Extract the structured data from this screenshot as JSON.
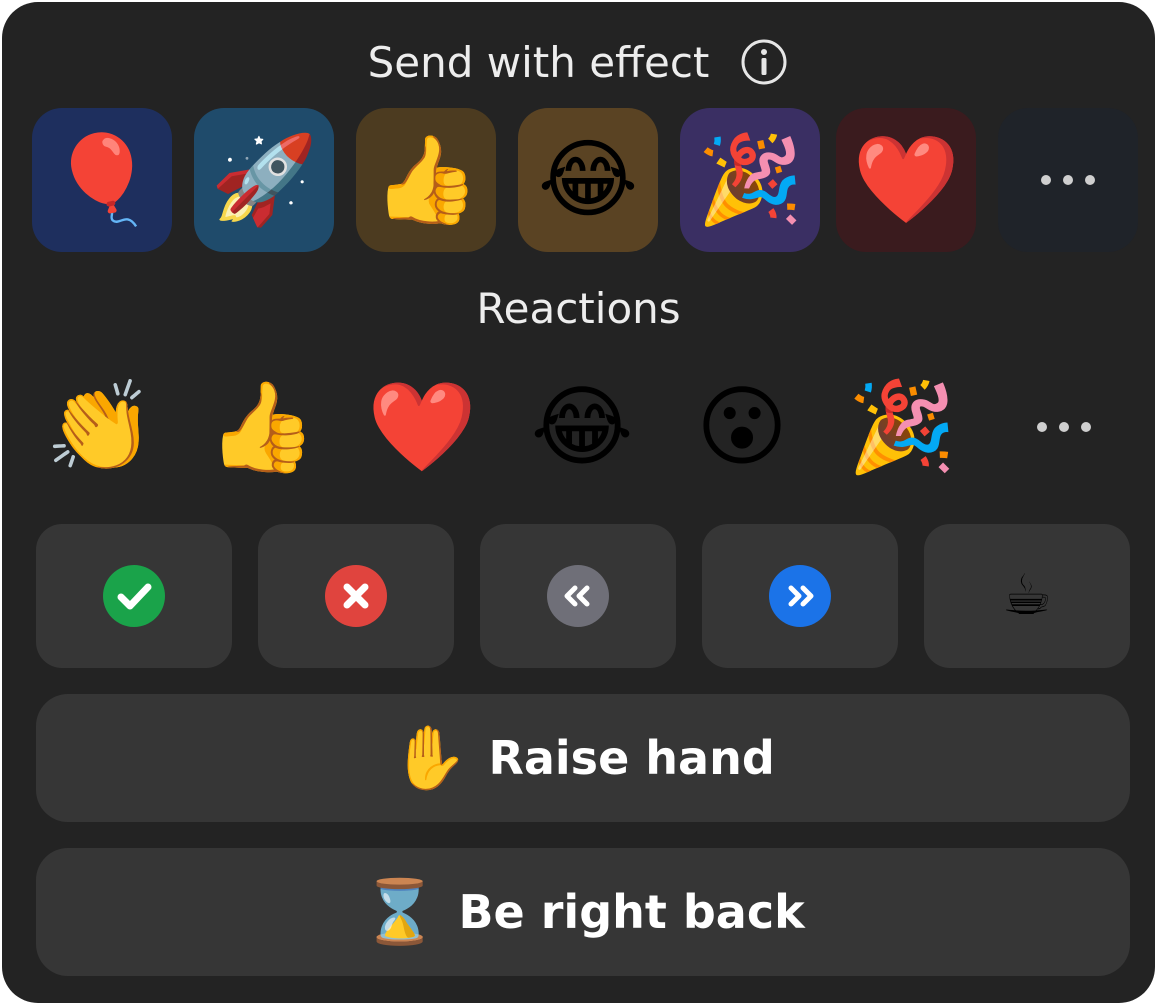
{
  "header": {
    "title": "Send with effect",
    "info_icon": "info-circle-icon"
  },
  "effects": [
    {
      "name": "balloon",
      "icon": "balloon-icon",
      "glyph": "🎈",
      "bg": "#1e2f5e"
    },
    {
      "name": "rocket",
      "icon": "rocket-icon",
      "glyph": "🚀",
      "bg": "#1f4b6b"
    },
    {
      "name": "thumbs-up",
      "icon": "thumbs-up-icon",
      "glyph": "👍",
      "bg": "#4c3b20"
    },
    {
      "name": "tears-of-joy",
      "icon": "tears-of-joy-icon",
      "glyph": "😂",
      "bg": "#5a4323"
    },
    {
      "name": "party",
      "icon": "party-popper-icon",
      "glyph": "🎉",
      "bg": "#3a2f63"
    },
    {
      "name": "heart",
      "icon": "heart-icon",
      "glyph": "❤️",
      "bg": "#3a1b1e"
    },
    {
      "name": "more",
      "icon": "more-icon",
      "glyph": "",
      "bg": "#1f2329"
    }
  ],
  "reactions_section": {
    "label": "Reactions",
    "items": [
      {
        "name": "clap",
        "icon": "clapping-hands-icon",
        "glyph": "👏"
      },
      {
        "name": "thumbs-up",
        "icon": "thumbs-up-icon",
        "glyph": "👍"
      },
      {
        "name": "heart",
        "icon": "heart-icon",
        "glyph": "❤️"
      },
      {
        "name": "tears-of-joy",
        "icon": "tears-of-joy-icon",
        "glyph": "😂"
      },
      {
        "name": "surprised",
        "icon": "surprised-face-icon",
        "glyph": "😮"
      },
      {
        "name": "party",
        "icon": "party-popper-icon",
        "glyph": "🎉"
      },
      {
        "name": "more",
        "icon": "more-icon",
        "glyph": ""
      }
    ]
  },
  "status_buttons": [
    {
      "name": "yes",
      "icon": "check-icon",
      "color": "#1aa34a"
    },
    {
      "name": "no",
      "icon": "x-icon",
      "color": "#e0443e"
    },
    {
      "name": "slow-down",
      "icon": "rewind-icon",
      "color": "#6f6f78"
    },
    {
      "name": "speed-up",
      "icon": "fast-forward-icon",
      "color": "#1b73e8"
    },
    {
      "name": "coffee",
      "icon": "coffee-icon",
      "glyph": "☕"
    }
  ],
  "raise_hand": {
    "label": "Raise hand",
    "icon": "raised-hand-icon",
    "glyph": "✋"
  },
  "be_right_back": {
    "label": "Be right back",
    "icon": "hourglass-icon",
    "glyph": "⌛"
  }
}
